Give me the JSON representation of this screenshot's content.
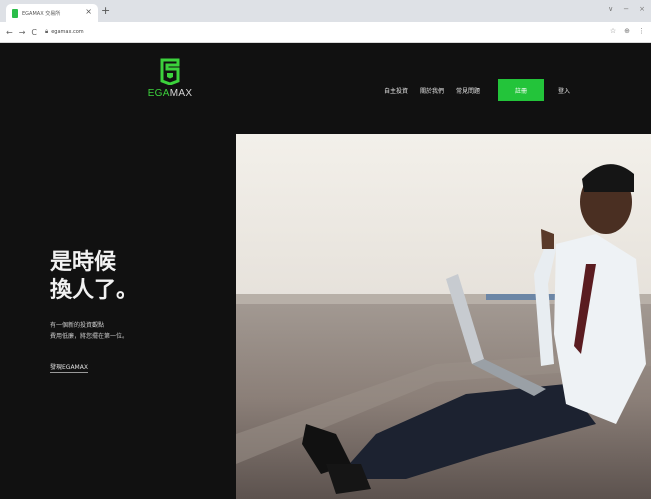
{
  "browser": {
    "tab_title": "EGAMAX 交易所",
    "tab_close": "×",
    "new_tab": "+",
    "window_controls": [
      "∨",
      "−",
      "×"
    ],
    "nav": {
      "back": "←",
      "forward": "→",
      "reload": "C"
    },
    "url": "egamax.com",
    "toolbar_icons": [
      "☆",
      "⊕",
      "⋮"
    ]
  },
  "site": {
    "logo": {
      "name_highlight": "EGA",
      "name_rest": "MAX",
      "accent": "#3cd23c"
    },
    "nav": {
      "items": [
        "自主投資",
        "關於我們",
        "常見問題"
      ],
      "register": "註冊",
      "login": "登入"
    },
    "hero": {
      "headline_line1": "是時候",
      "headline_line2": "換人了。",
      "subtext_line1": "有一個新的投資觀點",
      "subtext_line2": "費用低廉，將您擺在第一位。",
      "cta": "發現EGAMAX"
    },
    "colors": {
      "background": "#111111",
      "brand_green": "#23c43a"
    }
  }
}
